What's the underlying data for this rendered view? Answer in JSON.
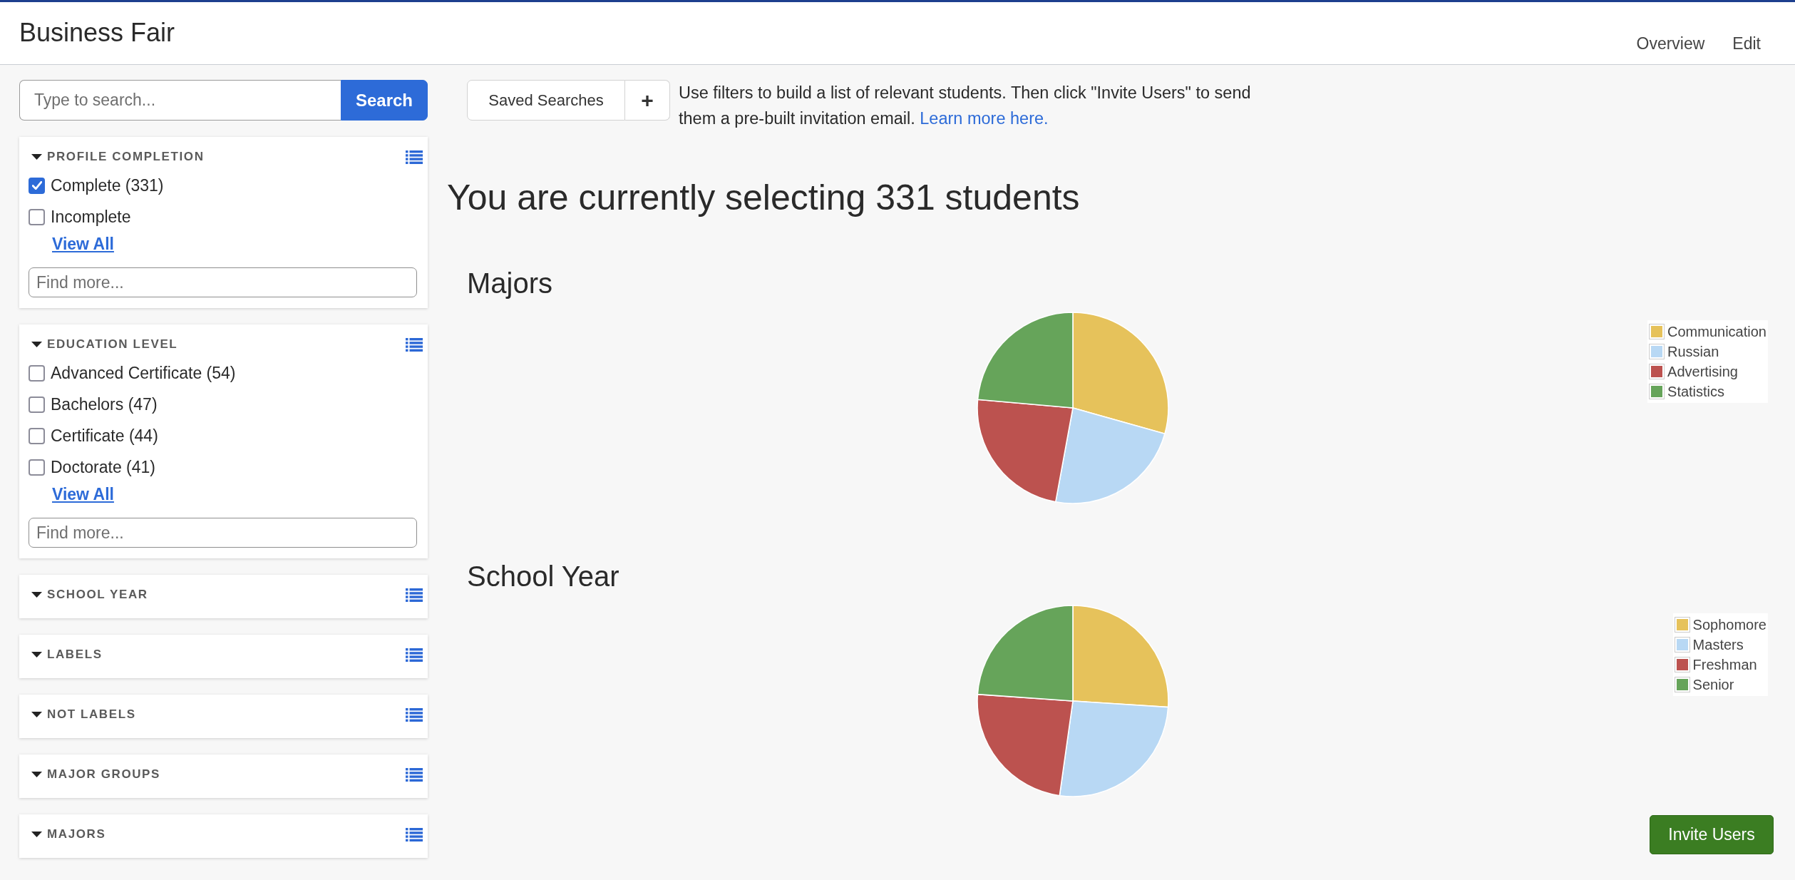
{
  "header": {
    "title": "Business Fair",
    "nav": [
      {
        "label": "Overview"
      },
      {
        "label": "Edit"
      }
    ]
  },
  "search": {
    "placeholder": "Type to search...",
    "button": "Search"
  },
  "filters": [
    {
      "title": "PROFILE COMPLETION",
      "options": [
        {
          "label": "Complete (331)",
          "checked": true
        },
        {
          "label": "Incomplete",
          "checked": false
        }
      ],
      "view_all": "View All",
      "find_placeholder": "Find more..."
    },
    {
      "title": "EDUCATION LEVEL",
      "options": [
        {
          "label": "Advanced Certificate (54)",
          "checked": false
        },
        {
          "label": "Bachelors (47)",
          "checked": false
        },
        {
          "label": "Certificate (44)",
          "checked": false
        },
        {
          "label": "Doctorate (41)",
          "checked": false
        }
      ],
      "view_all": "View All",
      "find_placeholder": "Find more..."
    },
    {
      "title": "SCHOOL YEAR"
    },
    {
      "title": "LABELS"
    },
    {
      "title": "NOT LABELS"
    },
    {
      "title": "MAJOR GROUPS"
    },
    {
      "title": "MAJORS"
    }
  ],
  "toolbar": {
    "saved_searches": "Saved Searches",
    "add": "+",
    "help": "Use filters to build a list of relevant students. Then click \"Invite Users\" to send them a pre-built invitation email.",
    "link": "Learn more here."
  },
  "heading": "You are currently selecting 331 students",
  "charts": [
    {
      "title": "Majors",
      "legend": [
        {
          "label": "Communication",
          "color": "#e6c25b"
        },
        {
          "label": "Russian",
          "color": "#b8d8f4"
        },
        {
          "label": "Advertising",
          "color": "#bc524f"
        },
        {
          "label": "Statistics",
          "color": "#66a45a"
        }
      ]
    },
    {
      "title": "School Year",
      "legend": [
        {
          "label": "Sophomore",
          "color": "#e6c25b"
        },
        {
          "label": "Masters",
          "color": "#b8d8f4"
        },
        {
          "label": "Freshman",
          "color": "#bc524f"
        },
        {
          "label": "Senior",
          "color": "#66a45a"
        }
      ]
    }
  ],
  "invite_button": "Invite Users"
}
